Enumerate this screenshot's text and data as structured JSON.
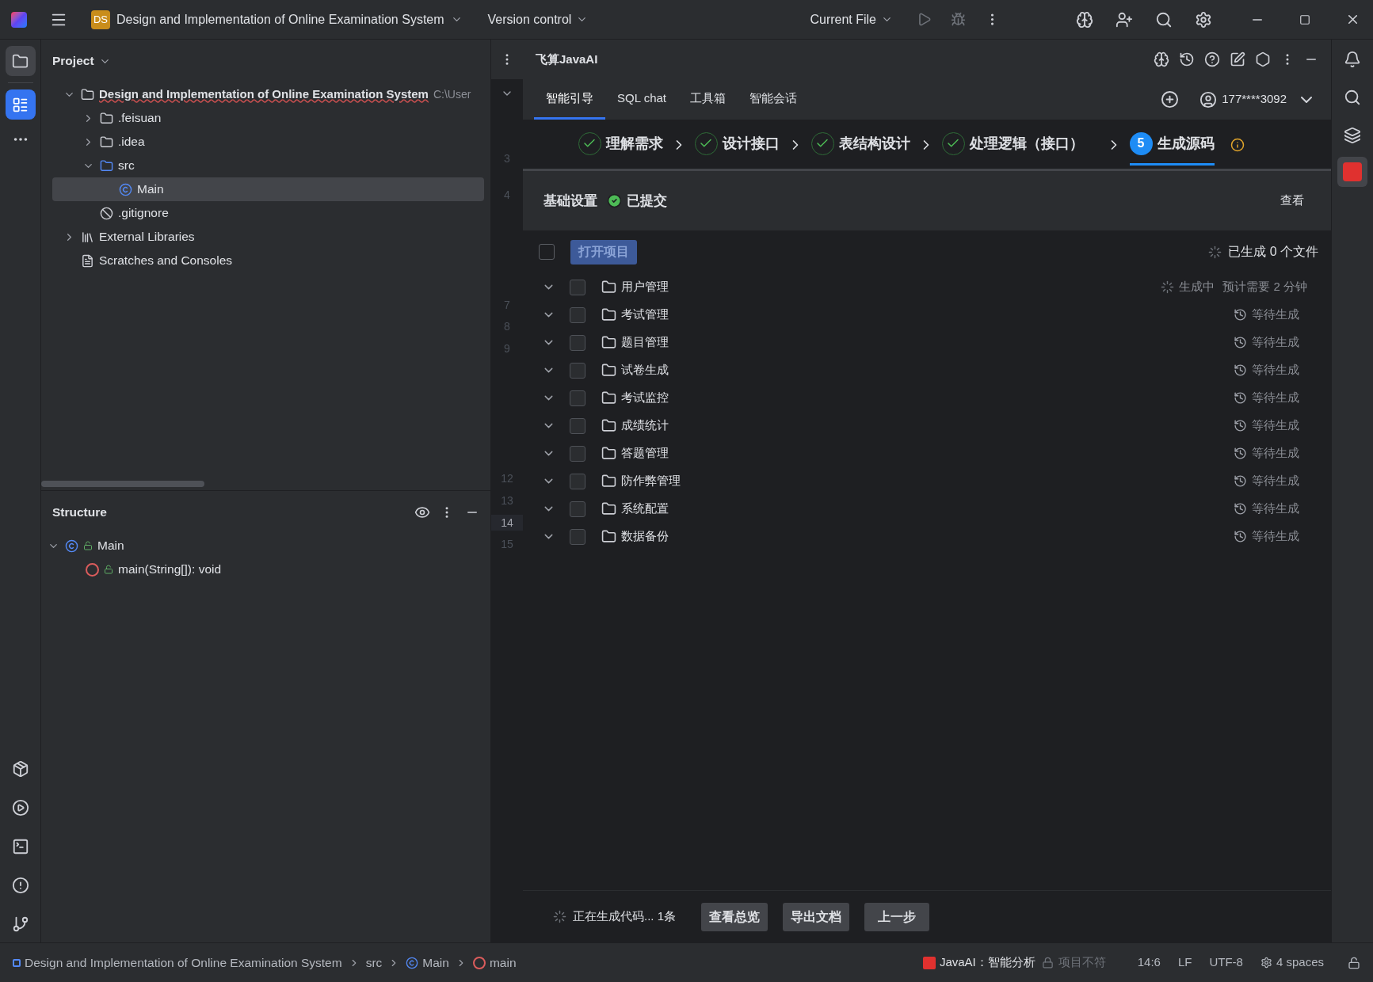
{
  "title_bar": {
    "project_badge": "DS",
    "project_name": "Design and Implementation of Online Examination System",
    "vcs": "Version control",
    "run_config": "Current File"
  },
  "project_panel": {
    "title": "Project",
    "tree": [
      {
        "name": "Design and Implementation of Online Examination System",
        "kind": "module",
        "path": "C:\\User",
        "expanded": true,
        "selected": false,
        "children": [
          {
            "name": ".feisuan",
            "kind": "folder",
            "expanded": false,
            "selected": false
          },
          {
            "name": ".idea",
            "kind": "folder",
            "expanded": false,
            "selected": false
          },
          {
            "name": "src",
            "kind": "source",
            "expanded": true,
            "selected": false,
            "children": [
              {
                "name": "Main",
                "kind": "class",
                "selected": true
              }
            ]
          },
          {
            "name": ".gitignore",
            "kind": "ignore",
            "selected": false
          }
        ]
      },
      {
        "name": "External Libraries",
        "kind": "libraries",
        "expanded": false,
        "selected": false
      },
      {
        "name": "Scratches and Consoles",
        "kind": "scratches",
        "selected": false
      }
    ]
  },
  "structure_panel": {
    "title": "Structure",
    "tree": [
      {
        "name": "Main",
        "kind": "class",
        "expanded": true,
        "children": [
          {
            "name": "main(String[]): void",
            "kind": "method"
          }
        ]
      }
    ]
  },
  "gutter": {
    "lines": [
      {
        "label": "3",
        "selected": false
      },
      {
        "label": "4",
        "selected": false
      },
      {
        "label": "7",
        "selected": false
      },
      {
        "label": "8",
        "selected": false
      },
      {
        "label": "9",
        "selected": false
      },
      {
        "label": "12",
        "selected": false
      },
      {
        "label": "13",
        "selected": false
      },
      {
        "label": "14",
        "selected": true
      },
      {
        "label": "15",
        "selected": false
      }
    ]
  },
  "ai_panel": {
    "title": "飞算JavaAI",
    "tabs": [
      {
        "label": "智能引导",
        "selected": true
      },
      {
        "label": "SQL chat",
        "selected": false
      },
      {
        "label": "工具箱",
        "selected": false
      },
      {
        "label": "智能会话",
        "selected": false
      }
    ],
    "account": "177****3092",
    "steps": [
      {
        "label": "理解需求",
        "done": true,
        "selected": false
      },
      {
        "label": "设计接口",
        "done": true,
        "selected": false
      },
      {
        "label": "表结构设计",
        "done": true,
        "selected": false
      },
      {
        "label": "处理逻辑（接口）",
        "done": true,
        "selected": false
      },
      {
        "label": "生成源码",
        "number": "5",
        "done": false,
        "selected": true
      }
    ],
    "settings": {
      "title": "基础设置",
      "status": "已提交",
      "action": "查看"
    },
    "header": {
      "checked": false,
      "button": "打开项目",
      "summary": "已生成 0 个文件"
    },
    "modules": [
      {
        "name": "用户管理",
        "checked": false,
        "kind": "generating",
        "status": "生成中",
        "eta": "预计需要 2 分钟"
      },
      {
        "name": "考试管理",
        "checked": false,
        "kind": "waiting",
        "status": "等待生成"
      },
      {
        "name": "题目管理",
        "checked": false,
        "kind": "waiting",
        "status": "等待生成"
      },
      {
        "name": "试卷生成",
        "checked": false,
        "kind": "waiting",
        "status": "等待生成"
      },
      {
        "name": "考试监控",
        "checked": false,
        "kind": "waiting",
        "status": "等待生成"
      },
      {
        "name": "成绩统计",
        "checked": false,
        "kind": "waiting",
        "status": "等待生成"
      },
      {
        "name": "答题管理",
        "checked": false,
        "kind": "waiting",
        "status": "等待生成"
      },
      {
        "name": "防作弊管理",
        "checked": false,
        "kind": "waiting",
        "status": "等待生成"
      },
      {
        "name": "系统配置",
        "checked": false,
        "kind": "waiting",
        "status": "等待生成"
      },
      {
        "name": "数据备份",
        "checked": false,
        "kind": "waiting",
        "status": "等待生成"
      }
    ],
    "footer": {
      "progress": "正在生成代码... 1条",
      "buttons": [
        "查看总览",
        "导出文档",
        "上一步"
      ]
    }
  },
  "status_bar": {
    "breadcrumbs": [
      {
        "label": "Design and Implementation of Online Examination System",
        "kind": "module"
      },
      {
        "label": "src",
        "kind": "folder"
      },
      {
        "label": "Main",
        "kind": "class"
      },
      {
        "label": "main",
        "kind": "method"
      }
    ],
    "plugin": "JavaAI：智能分析",
    "lock_text": "项目不符",
    "position": "14:6",
    "line_sep": "LF",
    "encoding": "UTF-8",
    "indent": "4 spaces"
  }
}
